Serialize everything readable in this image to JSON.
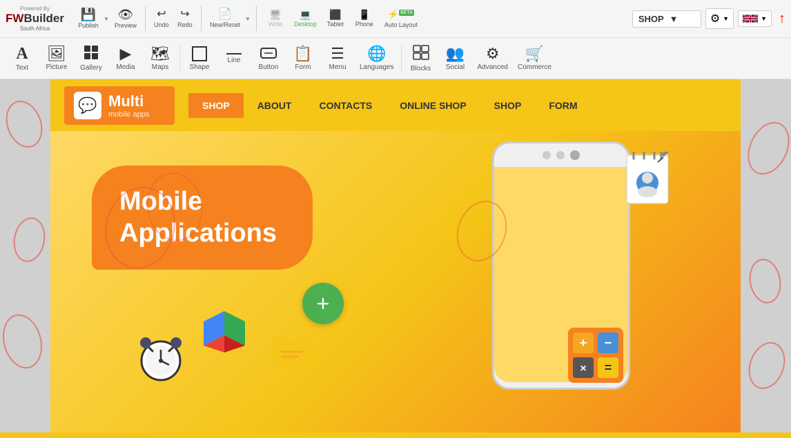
{
  "topbar": {
    "logo": {
      "powered": "Powered By",
      "main_part1": "FW",
      "main_part2": "Builder",
      "sub": "South Africa"
    },
    "buttons": [
      {
        "id": "publish",
        "icon": "💾",
        "label": "Publish",
        "has_arrow": true
      },
      {
        "id": "preview",
        "icon": "👁",
        "label": "Preview"
      },
      {
        "id": "undo",
        "icon": "↩",
        "label": "Undo"
      },
      {
        "id": "redo",
        "icon": "↪",
        "label": "Redo"
      },
      {
        "id": "new_reset",
        "icon": "📄",
        "label": "New/Reset",
        "has_arrow": true
      },
      {
        "id": "wide",
        "icon": "🖥",
        "label": "Wide"
      },
      {
        "id": "desktop",
        "icon": "💻",
        "label": "Desktop"
      },
      {
        "id": "tablet",
        "icon": "⬛",
        "label": "Tablet"
      },
      {
        "id": "phone",
        "icon": "📱",
        "label": "Phone"
      },
      {
        "id": "auto_layout",
        "icon": "⚡",
        "label": "Auto Layout",
        "has_beta": true
      }
    ],
    "shop_label": "SHOP",
    "right_arrow": "↑"
  },
  "toolbar2": {
    "tools": [
      {
        "id": "text",
        "icon": "A",
        "label": "Text"
      },
      {
        "id": "picture",
        "icon": "🖼",
        "label": "Picture"
      },
      {
        "id": "gallery",
        "icon": "⬛⬛",
        "label": "Gallery"
      },
      {
        "id": "media",
        "icon": "▶",
        "label": "Media"
      },
      {
        "id": "maps",
        "icon": "🗺",
        "label": "Maps"
      },
      {
        "id": "shape",
        "icon": "□",
        "label": "Shape"
      },
      {
        "id": "line",
        "icon": "—",
        "label": "Line"
      },
      {
        "id": "button",
        "icon": "⬜",
        "label": "Button"
      },
      {
        "id": "form",
        "icon": "📋",
        "label": "Form"
      },
      {
        "id": "menu",
        "icon": "☰",
        "label": "Menu"
      },
      {
        "id": "languages",
        "icon": "🌐",
        "label": "Languages"
      },
      {
        "id": "blocks",
        "icon": "⊞",
        "label": "Blocks"
      },
      {
        "id": "social",
        "icon": "👥",
        "label": "Social"
      },
      {
        "id": "advanced",
        "icon": "⚙",
        "label": "Advanced"
      },
      {
        "id": "commerce",
        "icon": "🛒",
        "label": "Commerce"
      }
    ]
  },
  "site": {
    "logo": {
      "icon": "💬",
      "main": "Multi",
      "sub": "mobile apps"
    },
    "nav": [
      {
        "label": "SHOP",
        "active": true
      },
      {
        "label": "ABOUT",
        "active": false
      },
      {
        "label": "CONTACTS",
        "active": false
      },
      {
        "label": "ONLINE SHOP",
        "active": false
      },
      {
        "label": "SHOP",
        "active": false
      },
      {
        "label": "FORM",
        "active": false
      }
    ],
    "hero": {
      "title_line1": "Mobile",
      "title_line2": "Applications"
    }
  }
}
